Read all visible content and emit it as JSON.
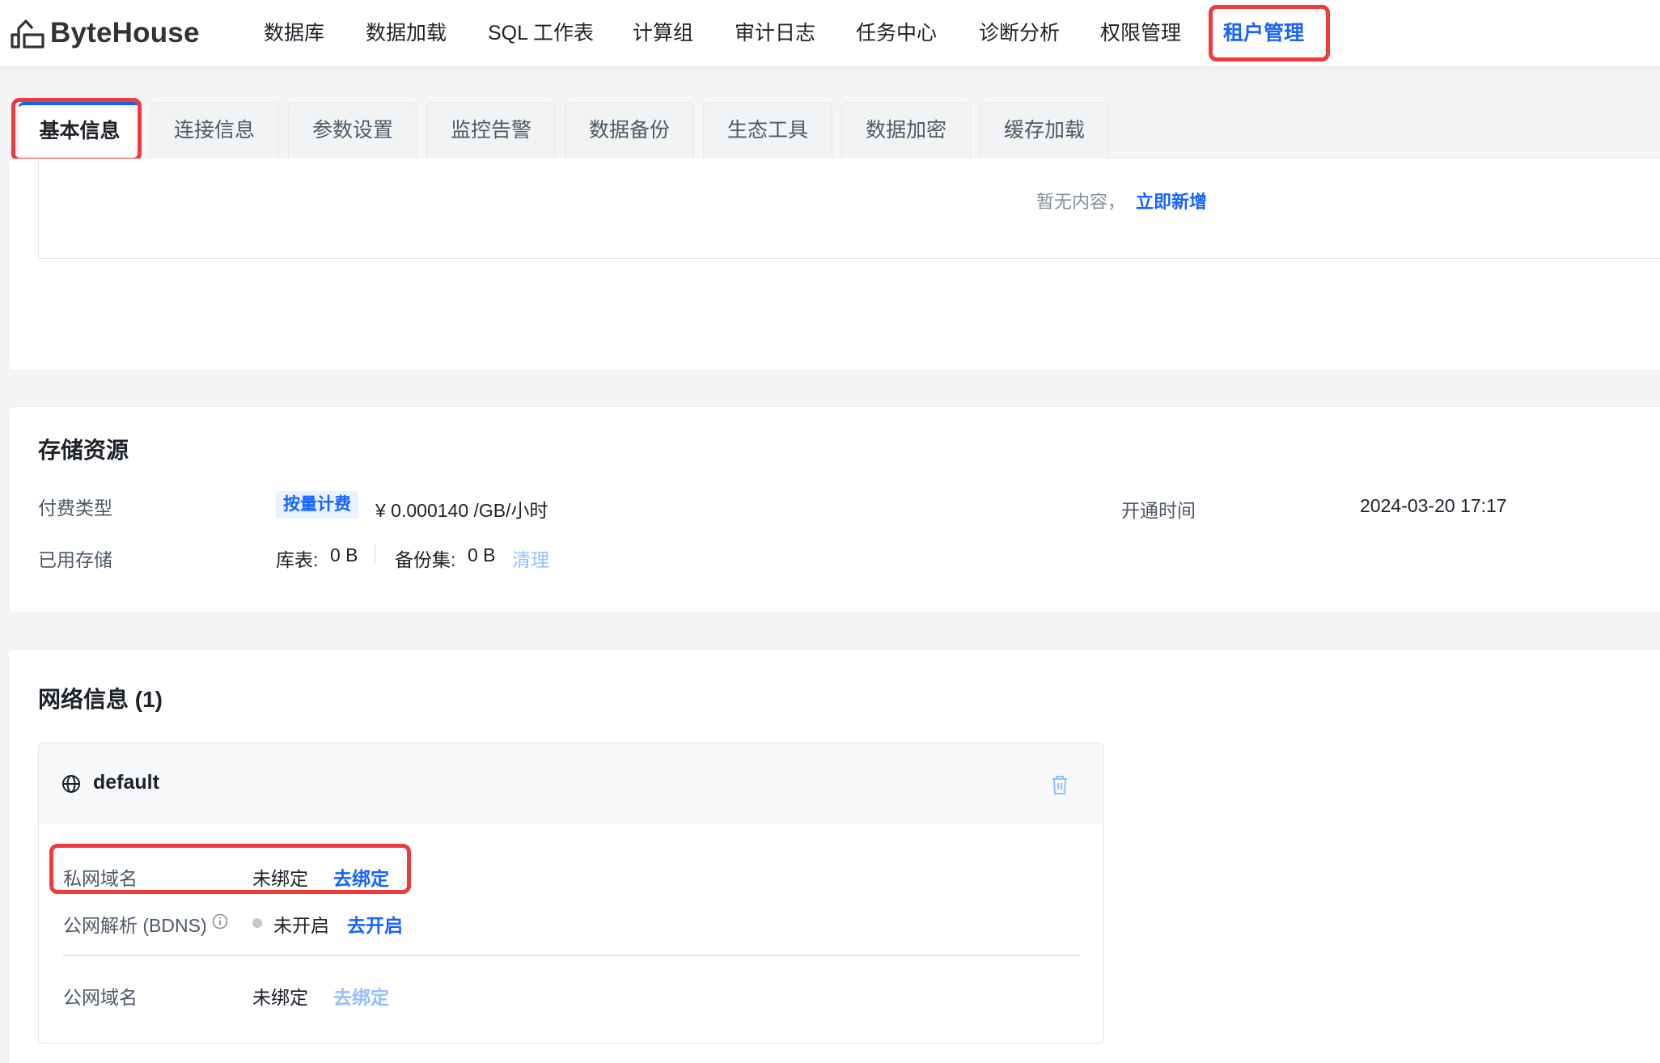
{
  "brand": {
    "name": "ByteHouse"
  },
  "nav": {
    "items": [
      {
        "label": "数据库"
      },
      {
        "label": "数据加载"
      },
      {
        "label": "SQL 工作表"
      },
      {
        "label": "计算组"
      },
      {
        "label": "审计日志"
      },
      {
        "label": "任务中心"
      },
      {
        "label": "诊断分析"
      },
      {
        "label": "权限管理"
      },
      {
        "label": "租户管理",
        "active": true
      }
    ]
  },
  "tabs": {
    "items": [
      {
        "label": "基本信息",
        "active": true
      },
      {
        "label": "连接信息"
      },
      {
        "label": "参数设置"
      },
      {
        "label": "监控告警"
      },
      {
        "label": "数据备份"
      },
      {
        "label": "生态工具"
      },
      {
        "label": "数据加密"
      },
      {
        "label": "缓存加载"
      }
    ]
  },
  "empty_state": {
    "text": "暂无内容，",
    "action": "立即新增"
  },
  "storage": {
    "title": "存储资源",
    "billing_label": "付费类型",
    "billing_tag": "按量计费",
    "price": "¥ 0.000140 /GB/小时",
    "open_time_label": "开通时间",
    "open_time_value": "2024-03-20 17:17",
    "used_label": "已用存储",
    "tables_label": "库表:",
    "tables_value": "0 B",
    "backup_label": "备份集:",
    "backup_value": "0 B",
    "clean_action": "清理"
  },
  "network": {
    "title": "网络信息 (1)",
    "card": {
      "name": "default",
      "private_domain_label": "私网域名",
      "private_domain_status": "未绑定",
      "private_domain_action": "去绑定",
      "bdns_label": "公网解析 (BDNS)",
      "bdns_status": "未开启",
      "bdns_action": "去开启",
      "public_domain_label": "公网域名",
      "public_domain_status": "未绑定",
      "public_domain_action": "去绑定"
    }
  },
  "colors": {
    "accent": "#1664ff",
    "highlight": "#ef3b3b",
    "text": "#1d2129",
    "muted": "#4e5969"
  }
}
